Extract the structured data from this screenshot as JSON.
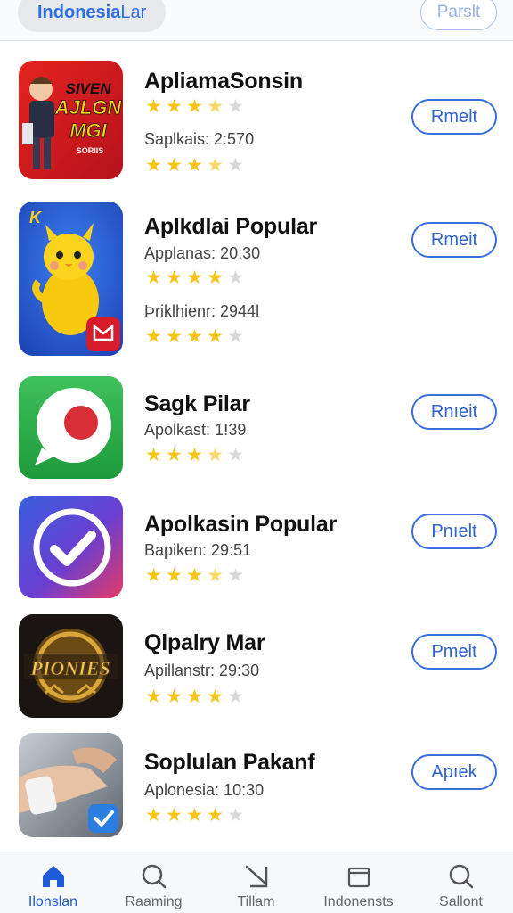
{
  "header": {
    "region_main": "Indonesia",
    "region_rest": " Lar",
    "right_button": "Parslt"
  },
  "colors": {
    "accent": "#2f63cf",
    "star": "#f5c518",
    "divider": "#e3e5e8"
  },
  "apps": [
    {
      "title": "ApliamaSonsin",
      "icon": "superhero-poster-icon",
      "icon_text": [
        "SIVEN",
        "AJLGN",
        "MGI",
        "SORIIS"
      ],
      "rating_1": 3.5,
      "meta_2": "Saplkais: 2:570",
      "rating_2": 3.5,
      "button": "Rmelt"
    },
    {
      "title": "Aplkdlai Popular",
      "icon": "yellow-chick-icon",
      "icon_text": [
        "K"
      ],
      "meta_1": "Applanas: 20:30",
      "rating_1": 4,
      "meta_2": "Þriklhienr: 2944l",
      "rating_2": 4,
      "button": "Rmeit"
    },
    {
      "title": "Sagk Pilar",
      "icon": "chat-bubble-icon",
      "meta_1": "Apolkast: 1ⵑ39",
      "rating_1": 3.5,
      "button": "Rnıeit"
    },
    {
      "title": "Apolkasin Popular",
      "icon": "checkmark-badge-icon",
      "meta_1": "Bapiken: 29:51",
      "rating_1": 3.5,
      "button": "Pnıelt"
    },
    {
      "title": "Qlpalry Mar",
      "icon": "gold-emblem-icon",
      "icon_text": [
        "PIONIES"
      ],
      "meta_1": "Apillanstr: 29:30",
      "rating_1": 4,
      "button": "Pmelt"
    },
    {
      "title": "Soplulan Pakanf",
      "icon": "wrist-photo-icon",
      "meta_1": "Aplonesia: 10:30",
      "rating_1": 4,
      "button": "Apıek"
    }
  ],
  "tabs": [
    {
      "label": "Ilonslan",
      "icon": "home-icon",
      "active": true
    },
    {
      "label": "Raaming",
      "icon": "search-icon",
      "active": false
    },
    {
      "label": "Tillam",
      "icon": "arrow-icon",
      "active": false
    },
    {
      "label": "Indonensts",
      "icon": "folder-icon",
      "active": false
    },
    {
      "label": "Sallont",
      "icon": "search-icon",
      "active": false
    }
  ]
}
